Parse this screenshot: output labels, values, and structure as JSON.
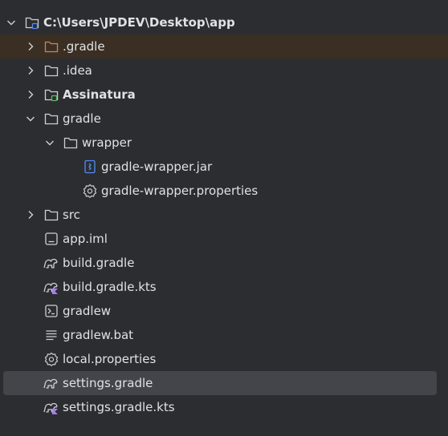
{
  "project_tree": {
    "root": {
      "label": "C:\\Users\\JPDEV\\Desktop\\app",
      "icon": "project-folder-icon",
      "expanded": true
    },
    "items": [
      {
        "label": ".gradle",
        "icon": "folder-icon",
        "expanded": false,
        "state": "excluded"
      },
      {
        "label": ".idea",
        "icon": "folder-icon",
        "expanded": false
      },
      {
        "label": "Assinatura",
        "icon": "module-folder-icon",
        "expanded": false
      },
      {
        "label": "gradle",
        "icon": "folder-icon",
        "expanded": true
      },
      {
        "label": "wrapper",
        "icon": "folder-icon",
        "expanded": true
      },
      {
        "label": "gradle-wrapper.jar",
        "icon": "jar-file-icon"
      },
      {
        "label": "gradle-wrapper.properties",
        "icon": "properties-gear-icon"
      },
      {
        "label": "src",
        "icon": "folder-icon",
        "expanded": false
      },
      {
        "label": "app.iml",
        "icon": "iml-file-icon"
      },
      {
        "label": "build.gradle",
        "icon": "gradle-elephant-icon"
      },
      {
        "label": "build.gradle.kts",
        "icon": "gradle-kotlin-icon"
      },
      {
        "label": "gradlew",
        "icon": "terminal-script-icon"
      },
      {
        "label": "gradlew.bat",
        "icon": "text-lines-icon"
      },
      {
        "label": "local.properties",
        "icon": "properties-gear-icon"
      },
      {
        "label": "settings.gradle",
        "icon": "gradle-elephant-icon",
        "state": "selected"
      },
      {
        "label": "settings.gradle.kts",
        "icon": "gradle-kotlin-icon"
      }
    ]
  },
  "colors": {
    "background": "#2b2d30",
    "text": "#dfe1e5",
    "excluded_row": "#3b2f23",
    "excluded_icon": "#c7875a",
    "selected_row": "#43454a",
    "icon_stroke": "#ced0d6",
    "module_badge": "#5fb865",
    "jar_accent": "#548af7",
    "kotlin_accent": "#a77ee8"
  }
}
